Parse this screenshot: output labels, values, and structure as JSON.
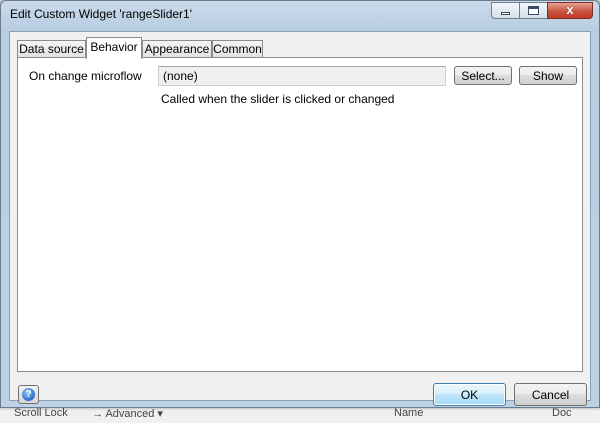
{
  "window": {
    "title": "Edit Custom Widget 'rangeSlider1'",
    "close_glyph": "x"
  },
  "tabs": [
    {
      "label": "Data source"
    },
    {
      "label": "Behavior",
      "active": true
    },
    {
      "label": "Appearance"
    },
    {
      "label": "Common"
    }
  ],
  "behavior": {
    "microflow_label": "On change microflow",
    "microflow_value": "(none)",
    "select_label": "Select...",
    "show_label": "Show",
    "hint": "Called when the slider is clicked or changed"
  },
  "footer": {
    "help_glyph": "?",
    "ok_label": "OK",
    "cancel_label": "Cancel"
  },
  "background_window": {
    "status_left": "Scroll Lock",
    "status_mid": "→ Advanced ▾",
    "status_name": "Name",
    "status_right": "Doc"
  },
  "colors": {
    "titlebar": "#b9cde2",
    "close_button": "#c7543e",
    "default_button": "#3c7fb1"
  }
}
